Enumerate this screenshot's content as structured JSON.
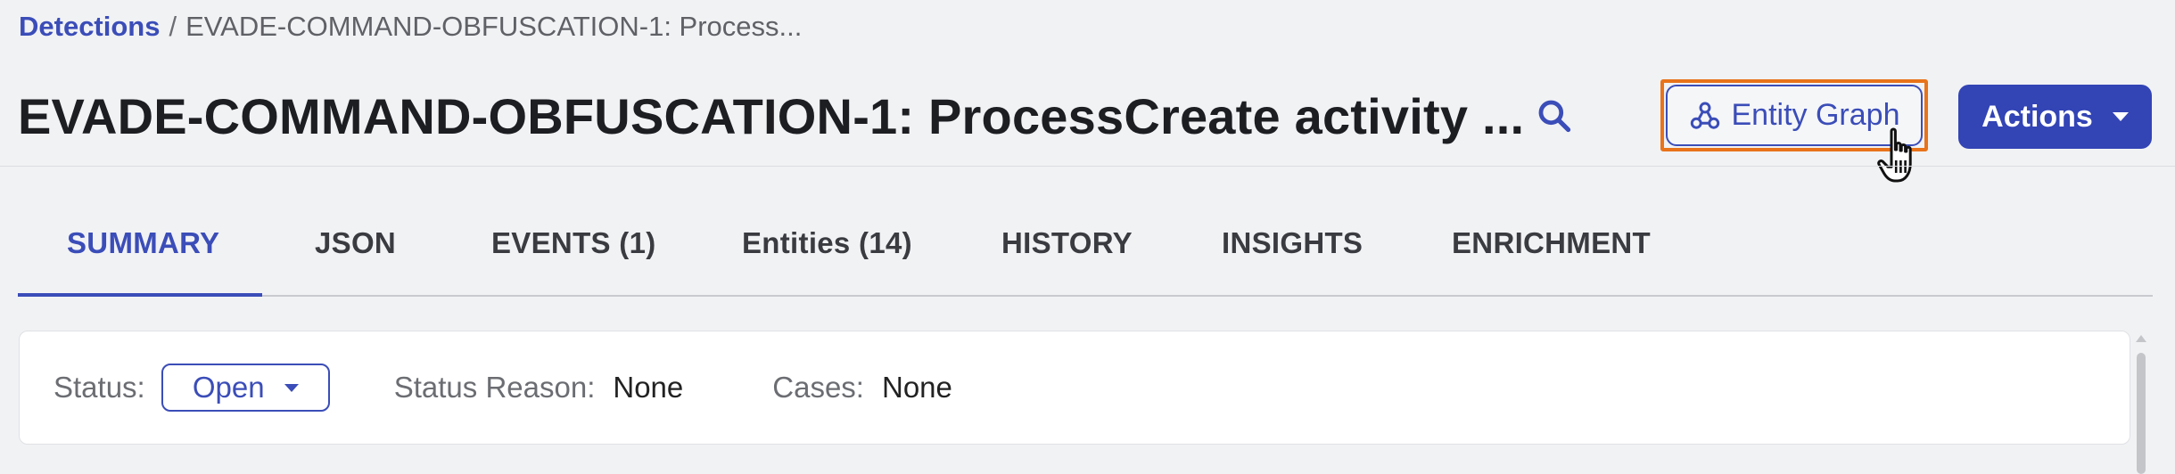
{
  "breadcrumb": {
    "link": "Detections",
    "separator": "/",
    "current": "EVADE-COMMAND-OBFUSCATION-1: Process..."
  },
  "header": {
    "title": "EVADE-COMMAND-OBFUSCATION-1: ProcessCreate activity ...",
    "search_icon": "search-icon",
    "entity_graph_label": "Entity Graph",
    "entity_graph_icon": "graph-nodes-icon",
    "actions_label": "Actions"
  },
  "tabs": [
    {
      "label": "SUMMARY",
      "active": true
    },
    {
      "label": "JSON"
    },
    {
      "label": "EVENTS (1)"
    },
    {
      "label": "Entities (14)"
    },
    {
      "label": "HISTORY"
    },
    {
      "label": "INSIGHTS"
    },
    {
      "label": "ENRICHMENT"
    }
  ],
  "status": {
    "status_label": "Status:",
    "status_value": "Open",
    "reason_label": "Status Reason:",
    "reason_value": "None",
    "cases_label": "Cases:",
    "cases_value": "None"
  },
  "colors": {
    "accent": "#3b4db8",
    "actions_bg": "#3344b5",
    "highlight_outline": "#e8731a",
    "page_bg": "#f1f2f4"
  }
}
